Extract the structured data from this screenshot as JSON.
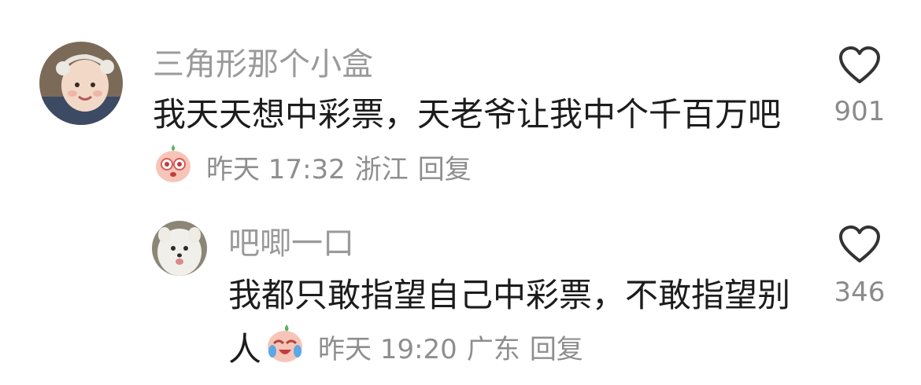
{
  "comments": [
    {
      "author": "三角形那个小盒",
      "text": "我天天想中彩票，天老爷让我中个千百万吧",
      "time": "昨天 17:32",
      "location": "浙江",
      "reply_label": "回复",
      "likes": "901",
      "avatar_icon": "child-photo-avatar",
      "emoji_icon": "peach-face-emoji"
    },
    {
      "author": "吧唧一口",
      "text_line1": "我都只敢指望自己中彩票，不敢指望别",
      "text_line2": "人",
      "time": "昨天 19:20",
      "location": "广东",
      "reply_label": "回复",
      "likes": "346",
      "avatar_icon": "dog-photo-avatar",
      "emoji_icon": "crying-laugh-peach-emoji"
    }
  ],
  "colors": {
    "name": "#9a9a9a",
    "text": "#1c1c1c",
    "meta": "#8e8e8e",
    "heart_stroke": "#333333"
  }
}
